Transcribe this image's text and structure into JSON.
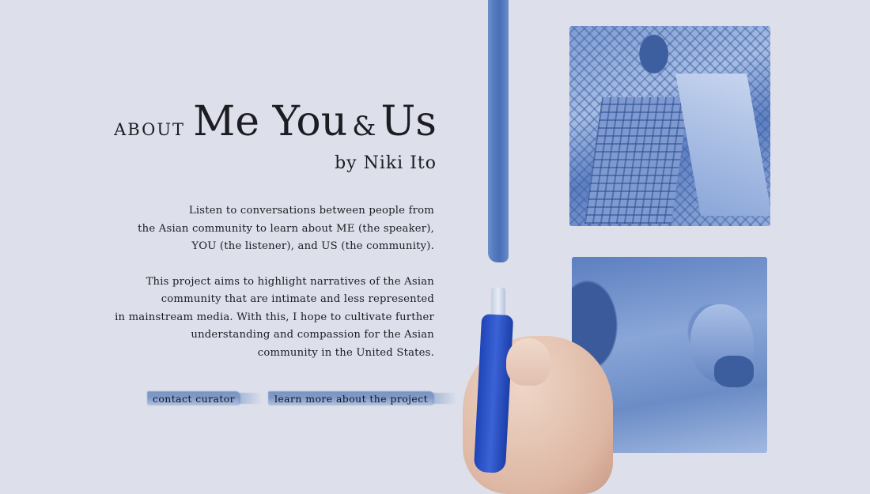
{
  "title": {
    "about": "ABOUT",
    "me_you": "Me You",
    "amp": "&",
    "us": "Us",
    "byline": "by Niki Ito"
  },
  "intro": {
    "lines": [
      "Listen to conversations between people from",
      "the Asian community to learn about ME (the speaker),",
      "YOU (the listener), and US (the community)."
    ]
  },
  "purpose": {
    "lines": [
      "This project aims to highlight narratives of the Asian",
      "community that are intimate and less represented",
      "in mainstream media. With this, I hope to cultivate further",
      "understanding and compassion for the Asian",
      "community in the United States."
    ]
  },
  "buttons": {
    "contact": "contact curator",
    "learn_more": "learn more about the project"
  },
  "colors": {
    "background": "#dde0ea",
    "ink_blue": "#4a70b6",
    "text": "#1c1c22"
  }
}
